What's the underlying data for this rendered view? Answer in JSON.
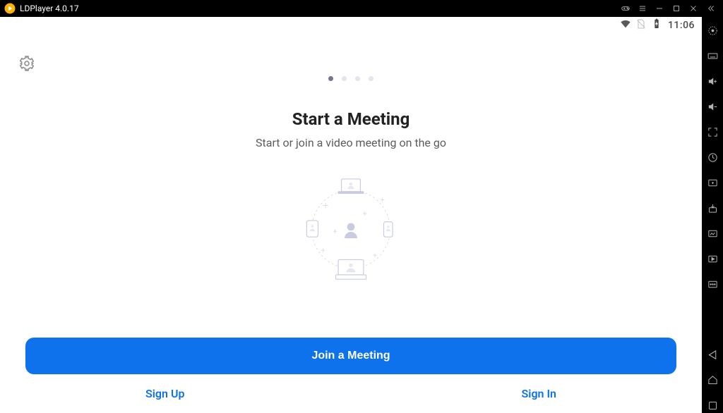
{
  "window": {
    "title": "LDPlayer 4.0.17"
  },
  "statusbar": {
    "time": "11:06"
  },
  "onboarding": {
    "page_index": 0,
    "page_count": 4,
    "heading": "Start a Meeting",
    "subheading": "Start or join a video meeting on the go"
  },
  "buttons": {
    "join": "Join a Meeting",
    "sign_up": "Sign Up",
    "sign_in": "Sign In"
  },
  "colors": {
    "primary": "#0e72ed"
  }
}
